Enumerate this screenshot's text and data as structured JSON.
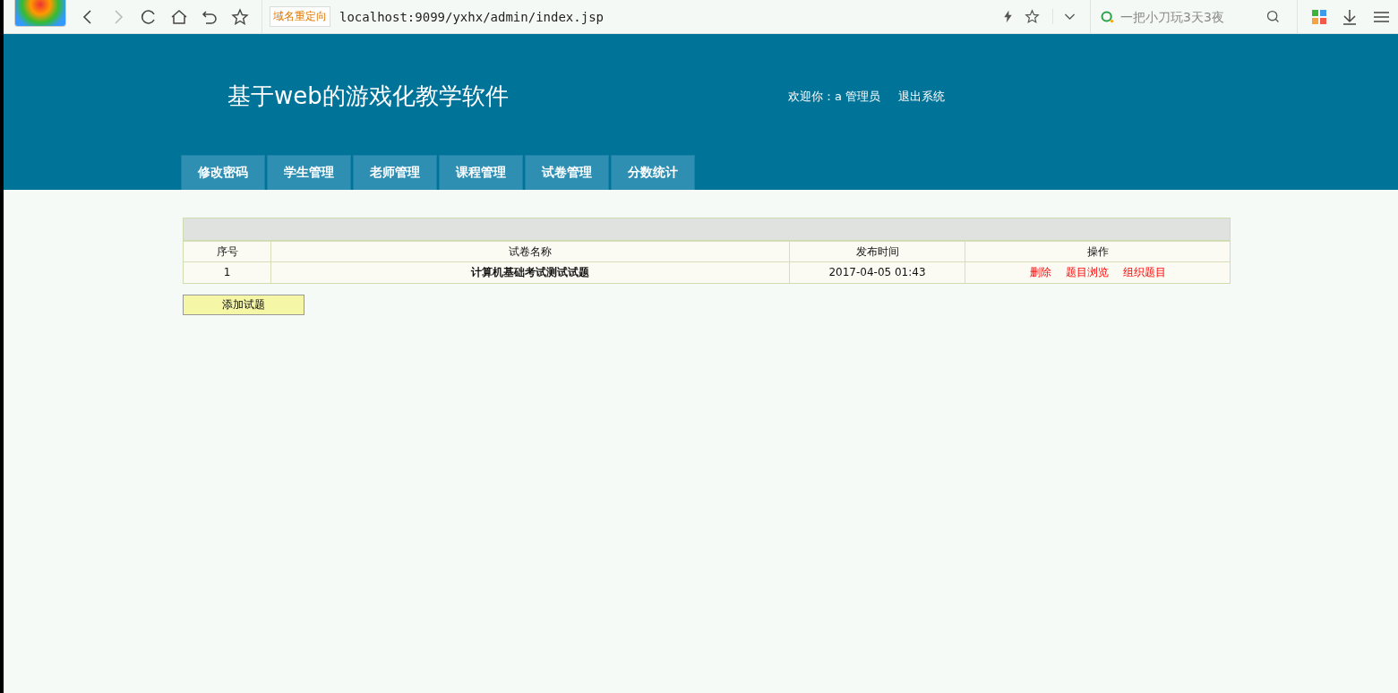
{
  "browser": {
    "redirect_badge": "域名重定向",
    "url": "localhost:9099/yxhx/admin/index.jsp",
    "search": {
      "placeholder": "一把小刀玩3天3夜"
    }
  },
  "header": {
    "title": "基于web的游戏化教学软件",
    "welcome": "欢迎你：a 管理员",
    "logout": "退出系统"
  },
  "nav": [
    {
      "label": "修改密码"
    },
    {
      "label": "学生管理"
    },
    {
      "label": "老师管理"
    },
    {
      "label": "课程管理"
    },
    {
      "label": "试卷管理"
    },
    {
      "label": "分数统计"
    }
  ],
  "table": {
    "columns": [
      "序号",
      "试卷名称",
      "发布时间",
      "操作"
    ],
    "rows": [
      {
        "cells": [
          "1",
          "计算机基础考试测试试题",
          "2017-04-05 01:43"
        ],
        "actions": [
          "删除",
          "题目浏览",
          "组织题目"
        ]
      }
    ]
  },
  "add_button": "添加试题"
}
